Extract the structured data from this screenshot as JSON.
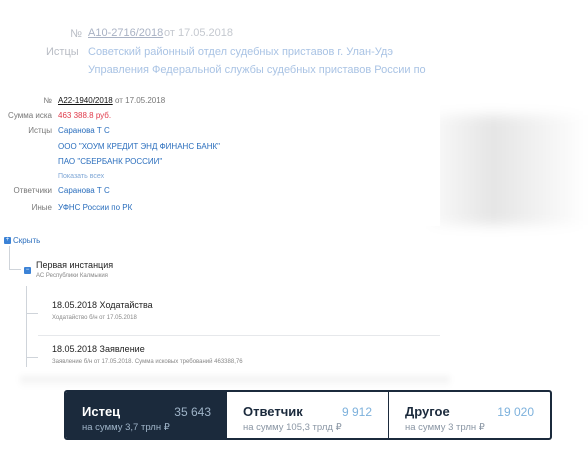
{
  "background_case": {
    "number_label": "№",
    "number": "А10-2716/2018",
    "date": "от 17.05.2018",
    "plaintiffs_label": "Истцы",
    "plaintiff_line1": "Советский районный отдел судебных приставов г. Улан-Удэ",
    "plaintiff_line2": "Управления Федеральной службы судебных приставов России по"
  },
  "case": {
    "number_label": "№",
    "number": "А22-1940/2018",
    "date": "от 17.05.2018",
    "amount_label": "Сумма иска",
    "amount": "463 388.8 руб.",
    "plaintiffs_label": "Истцы",
    "plaintiffs": [
      "Саранова Т С",
      "ООО \"ХОУМ КРЕДИТ ЭНД ФИНАНС БАНК\"",
      "ПАО \"СБЕРБАНК РОССИИ\""
    ],
    "show_all": "Показать всех",
    "defendants_label": "Ответчики",
    "defendant": "Саранова Т С",
    "others_label": "Иные",
    "other": "УФНС России по РК"
  },
  "tree": {
    "toggle_label": "Скрыть",
    "instance_title": "Первая инстанция",
    "instance_court": "АС Республики Калмыкия",
    "events": [
      {
        "title": "18.05.2018 Ходатайства",
        "detail": "Ходатайство б/н от 17.05.2018"
      },
      {
        "title": "18.05.2018 Заявление",
        "detail": "Заявление б/н от 17.05.2018. Сумма исковых требований 463388,76"
      }
    ]
  },
  "stats": [
    {
      "label": "Истец",
      "count": "35 643",
      "sum": "на сумму 3,7 трлн ₽"
    },
    {
      "label": "Ответчик",
      "count": "9 912",
      "sum": "на сумму 105,3 трлд ₽"
    },
    {
      "label": "Другое",
      "count": "19 020",
      "sum": "на сумму 3 трлн ₽"
    }
  ],
  "colors": {
    "accent": "#1b2a3c",
    "link": "#2a6ebd",
    "amount": "#e03a4a",
    "count": "#7db1dc"
  }
}
